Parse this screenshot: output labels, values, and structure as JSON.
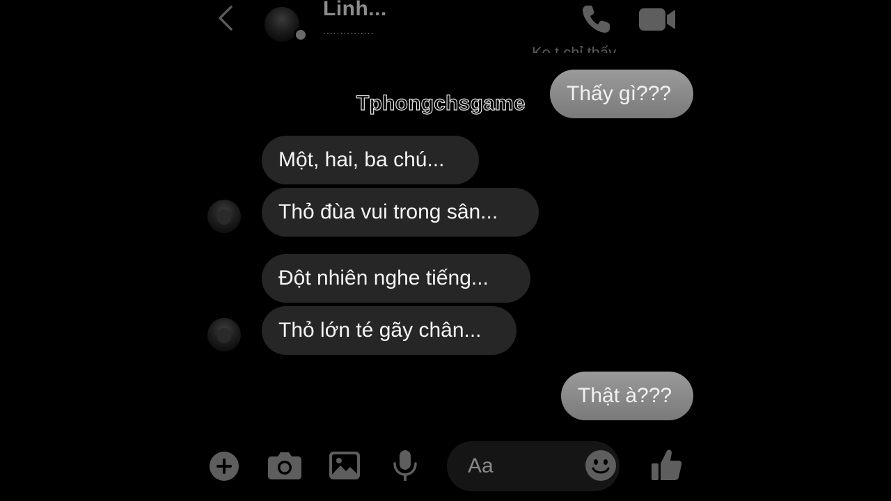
{
  "header": {
    "contact_name": "Linh...",
    "contact_status": "...............",
    "icons": {
      "back": "chevron-left-icon",
      "call": "phone-icon",
      "video": "video-camera-icon"
    }
  },
  "faded_previous_message": "Ko t chỉ thấy...",
  "watermark": "Tphongchsgame",
  "messages": [
    {
      "direction": "outgoing",
      "text": "Thấy gì???"
    },
    {
      "direction": "incoming",
      "text": "Một, hai, ba chú..."
    },
    {
      "direction": "incoming",
      "text": "Thỏ đùa vui trong sân..."
    },
    {
      "direction": "incoming",
      "text": "Đột nhiên nghe tiếng..."
    },
    {
      "direction": "incoming",
      "text": "Thỏ lớn té gãy chân..."
    },
    {
      "direction": "outgoing",
      "text": "Thật à???"
    }
  ],
  "composer": {
    "placeholder": "Aa",
    "icons": {
      "add": "plus-circle-icon",
      "camera": "camera-icon",
      "gallery": "image-icon",
      "mic": "microphone-icon",
      "emoji": "smiley-icon",
      "like": "thumbs-up-icon"
    }
  },
  "colors": {
    "background": "#000000",
    "outgoing_bubble": "#8a8a8a",
    "incoming_bubble": "#262626",
    "icon": "#5e5e5e"
  }
}
